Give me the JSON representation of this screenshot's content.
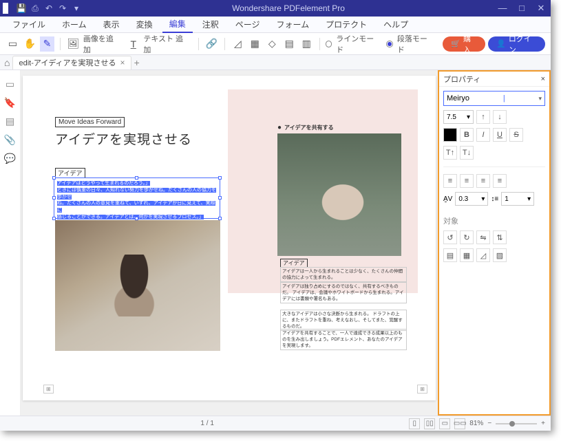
{
  "titlebar": {
    "title": "Wondershare PDFelement Pro"
  },
  "menubar": {
    "items": [
      "ファイル",
      "ホーム",
      "表示",
      "変換",
      "編集",
      "注釈",
      "ページ",
      "フォーム",
      "プロテクト",
      "ヘルプ"
    ],
    "active_index": 4
  },
  "toolbar": {
    "img_add": "画像を追加",
    "text_add": "テキスト 追加",
    "line_mode": "ラインモード",
    "para_mode": "段落モード",
    "buy": "購入",
    "login": "ログイン"
  },
  "tabs": {
    "tab1": "edit-アイディアを実現させる"
  },
  "doc": {
    "tagline": "Move Ideas Forward",
    "headline": "アイデアを実現させる",
    "idea_label": "アイデア",
    "sel_l1": "アイデアはどうやって生まれるのだろう。」",
    "sel_l2": "ときには慎重の日々、人知れない努力を歩かせね。たくさんの人の協力を歩かせ",
    "sel_l3": "ね。たくさんの人の意見を重ねて、いずれ、アイデアが日に見えて、実際に",
    "sel_l4": "感じることができる。アイデアとは、何かを実現させるプロセス。」",
    "share": "アイデアを共有する",
    "p2a": "アイデアは一人から生まれることは少なく、たくさんの仲間の協力によって生まれる。",
    "p2b": "アイデアは独り占めにするのではなく、共有するべきものだ。\nアイデアは、会議やホワイトボードから生まれる。アイデアには書類や署名もある。",
    "p2c": "大きなアイデアは小さな決断から生まれる。\nドラフトの上に、またドラフトを重ね、考えなおし、そしてまた、覚醒するものだ。",
    "p2d": "アイデアを共有することで、一人で達成できる成果以上のものを生み出しましょう。PDFエレメント、あなたのアイデアを実現します。"
  },
  "props": {
    "title": "プロパティ",
    "font": "Meiryo",
    "size": "7.5",
    "char_spacing": "0.3",
    "line_spacing": "1",
    "section_target": "対象"
  },
  "status": {
    "page": "1",
    "sep": "/",
    "total": "1",
    "zoom": "81%"
  }
}
